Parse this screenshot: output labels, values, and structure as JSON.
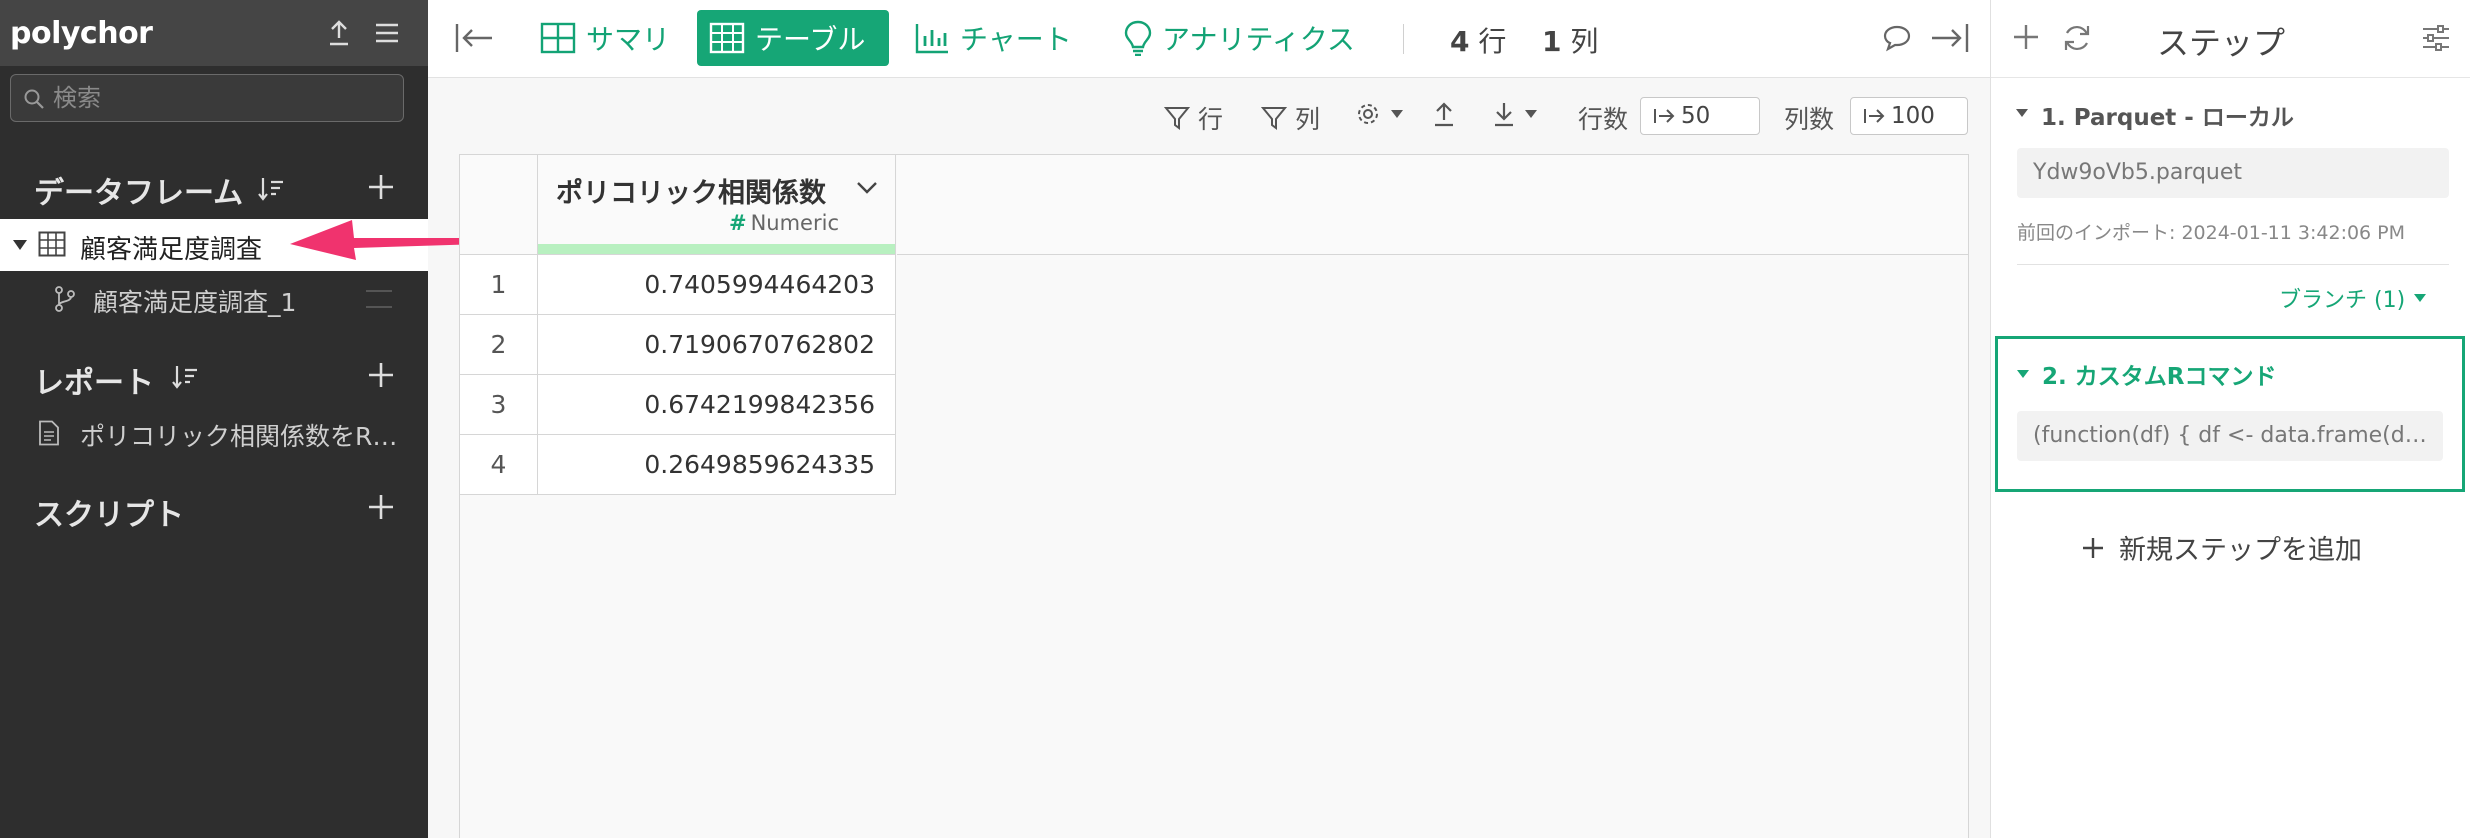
{
  "sidebar": {
    "brand": "polychor",
    "search_placeholder": "検索",
    "sections": {
      "dataframes": "データフレーム",
      "reports": "レポート",
      "scripts": "スクリプト"
    },
    "dataframe_item": "顧客満足度調査",
    "branch_item": "顧客満足度調査_1",
    "report_item": "ポリコリック相関係数をRで計算"
  },
  "toolbar": {
    "summary": "サマリ",
    "table": "テーブル",
    "chart": "チャート",
    "analytics": "アナリティクス",
    "rows_count": "4",
    "rows_unit": "行",
    "cols_count": "1",
    "cols_unit": "列"
  },
  "subtoolbar": {
    "row_filter": "行",
    "col_filter": "列",
    "rows_label": "行数",
    "rows_value": "50",
    "cols_label": "列数",
    "cols_value": "100"
  },
  "table": {
    "column": {
      "name": "ポリコリック相関係数",
      "type": "Numeric"
    },
    "rows": [
      {
        "index": "1",
        "value": "0.7405994464203"
      },
      {
        "index": "2",
        "value": "0.7190670762802"
      },
      {
        "index": "3",
        "value": "0.6742199842356"
      },
      {
        "index": "4",
        "value": "0.2649859624335"
      }
    ]
  },
  "steps_panel": {
    "title": "ステップ",
    "step1": {
      "title": "1. Parquet - ローカル",
      "file": "Ydw9oVb5.parquet",
      "prev_import": "前回のインポート: 2024-01-11 3:42:06 PM"
    },
    "branch_label": "ブランチ (1)",
    "step2": {
      "title": "2. カスタムRコマンド",
      "code": "(function(df) { df <- data.frame(df) %>% ..."
    },
    "add_step": "新規ステップを追加"
  },
  "colors": {
    "accent": "#16a676",
    "sidebar_bg": "#2e2e2e",
    "arrow": "#f0336e"
  }
}
